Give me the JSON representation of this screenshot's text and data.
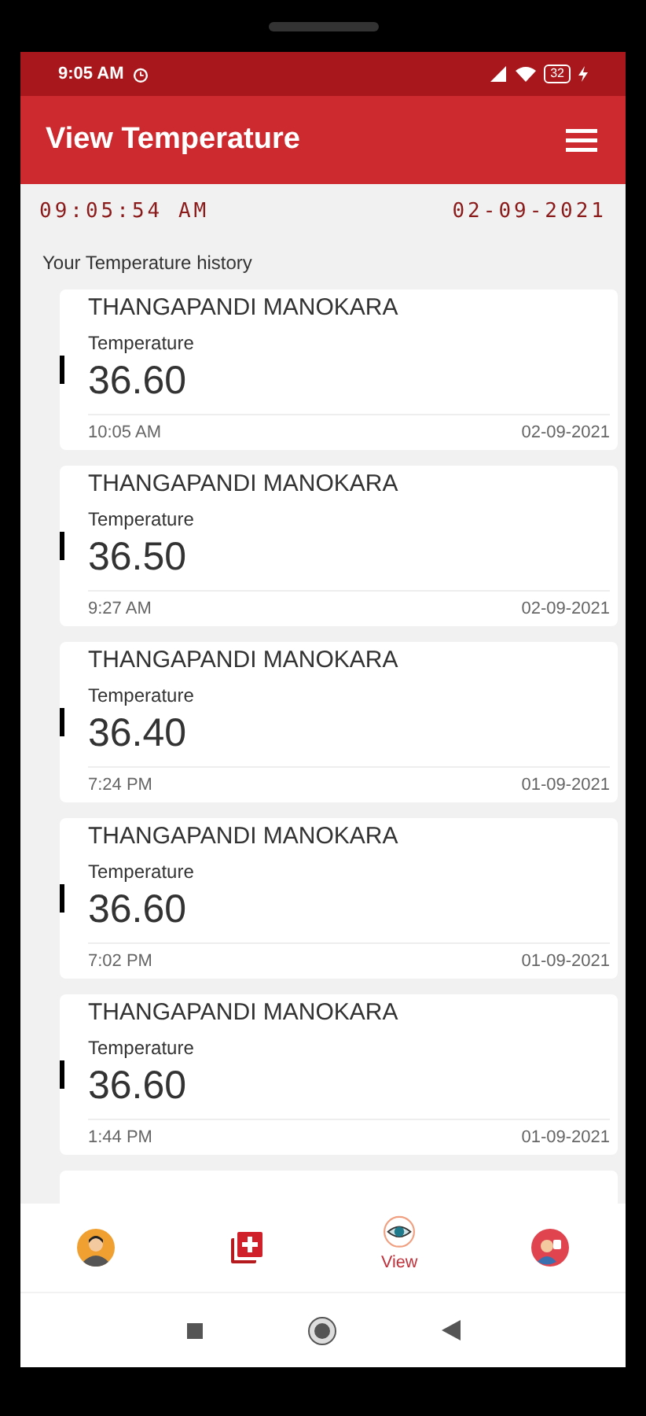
{
  "status_bar": {
    "time": "9:05 AM",
    "battery": "32"
  },
  "app_bar": {
    "title": "View Temperature"
  },
  "clock": {
    "time": "09:05:54 AM",
    "date": "02-09-2021"
  },
  "section_title": "Your Temperature history",
  "records": [
    {
      "name": "THANGAPANDI MANOKARA",
      "label": "Temperature",
      "value": "36.60",
      "time": "10:05 AM",
      "date": "02-09-2021"
    },
    {
      "name": "THANGAPANDI MANOKARA",
      "label": "Temperature",
      "value": "36.50",
      "time": "9:27 AM",
      "date": "02-09-2021"
    },
    {
      "name": "THANGAPANDI MANOKARA",
      "label": "Temperature",
      "value": "36.40",
      "time": "7:24 PM",
      "date": "01-09-2021"
    },
    {
      "name": "THANGAPANDI MANOKARA",
      "label": "Temperature",
      "value": "36.60",
      "time": "7:02 PM",
      "date": "01-09-2021"
    },
    {
      "name": "THANGAPANDI MANOKARA",
      "label": "Temperature",
      "value": "36.60",
      "time": "1:44 PM",
      "date": "01-09-2021"
    }
  ],
  "bottom_nav": [
    {
      "kind": "profile",
      "selected": false
    },
    {
      "kind": "add",
      "selected": false
    },
    {
      "kind": "view",
      "selected": true,
      "label": "View"
    },
    {
      "kind": "doctor",
      "selected": false
    }
  ]
}
